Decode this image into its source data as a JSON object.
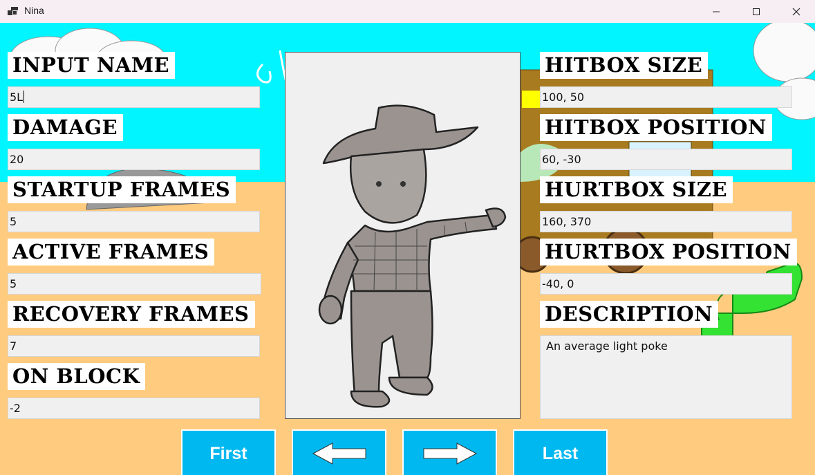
{
  "window": {
    "title": "Nina"
  },
  "fields_left": [
    {
      "label": "Input Name",
      "value": "5L"
    },
    {
      "label": "Damage",
      "value": "20"
    },
    {
      "label": "Startup Frames",
      "value": "5"
    },
    {
      "label": "Active Frames",
      "value": "5"
    },
    {
      "label": "Recovery Frames",
      "value": "7"
    },
    {
      "label": "On Block",
      "value": "-2"
    }
  ],
  "fields_right": [
    {
      "label": "Hitbox Size",
      "value": "100, 50"
    },
    {
      "label": "Hitbox Position",
      "value": "60, -30"
    },
    {
      "label": "Hurtbox Size",
      "value": "160, 370"
    },
    {
      "label": "Hurtbox Position",
      "value": "-40, 0"
    },
    {
      "label": "Description",
      "value": "An average light poke"
    }
  ],
  "nav": {
    "first_label": "First",
    "last_label": "Last",
    "prev_icon": "left-arrow-icon",
    "next_icon": "right-arrow-icon"
  },
  "colors": {
    "sky": "#00f5ff",
    "sand": "#ffcb7f",
    "button": "#00b8f0",
    "cactus": "#33e233"
  }
}
